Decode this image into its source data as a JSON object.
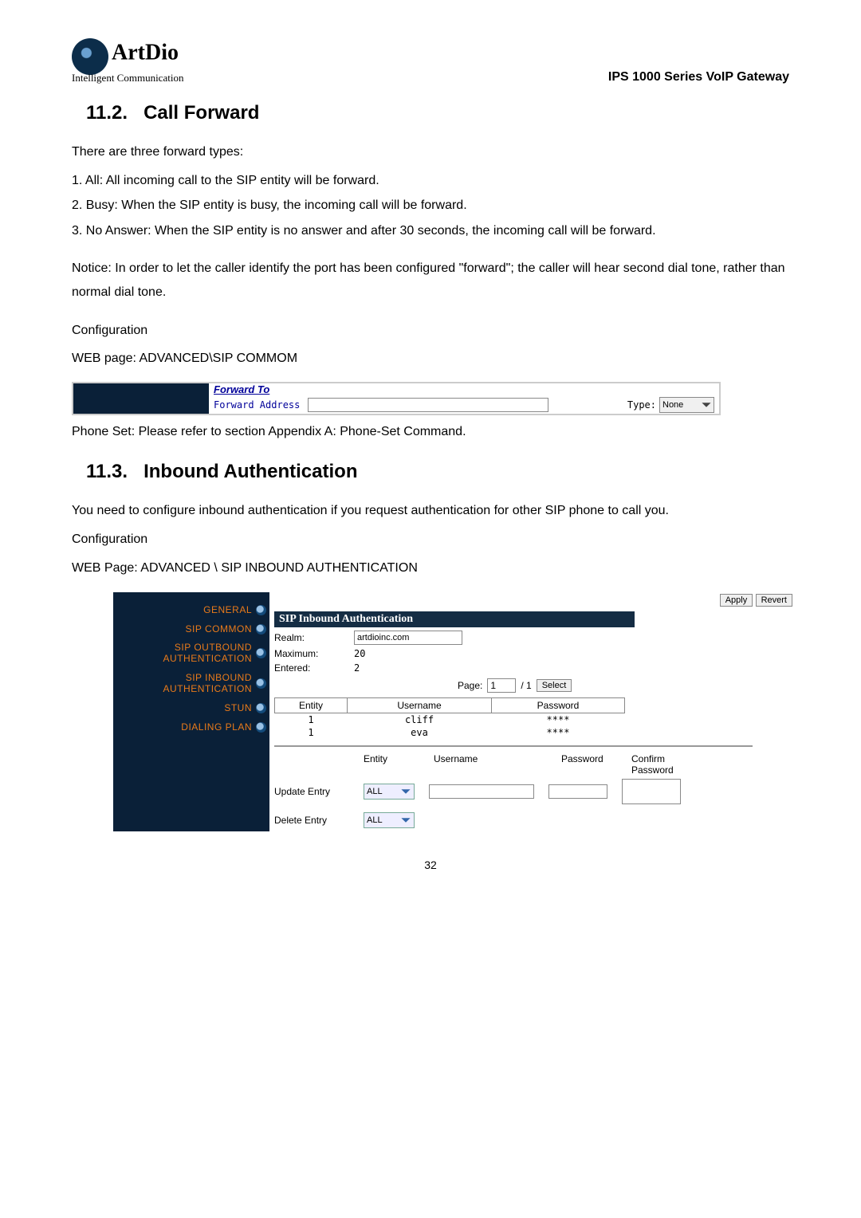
{
  "header": {
    "logo_main": "ArtDio",
    "logo_sub": "Intelligent Communication",
    "right": "IPS 1000 Series VoIP Gateway"
  },
  "sec1": {
    "num": "11.2.",
    "title": "Call Forward",
    "lead": "There are three forward types:",
    "items": [
      "1.  All: All incoming call to the SIP entity will be forward.",
      "2.  Busy: When the SIP entity is busy, the incoming call will be forward.",
      "3.  No Answer: When the SIP entity is no answer and after 30 seconds, the incoming call will be forward."
    ],
    "notice": "Notice: In order to let the caller identify the port has been configured \"forward\"; the caller will hear second dial tone, rather than normal dial tone.",
    "config_lbl": "Configuration",
    "web_lbl": "WEB page: ADVANCED\\SIP COMMOM"
  },
  "fwd": {
    "title": "Forward To",
    "addr_lbl": "Forward Address",
    "type_lbl": "Type:",
    "type_val": "None"
  },
  "after_fwd": "Phone Set: Please refer to section Appendix A: Phone-Set Command.",
  "sec2": {
    "num": "11.3.",
    "title": "Inbound Authentication",
    "lead": "You need to configure inbound authentication if you request authentication for other SIP phone to call you.",
    "config_lbl": "Configuration",
    "web_lbl": "WEB Page: ADVANCED \\ SIP INBOUND AUTHENTICATION"
  },
  "sidebar": {
    "items": [
      "GENERAL",
      "SIP COMMON",
      "SIP OUTBOUND\nAUTHENTICATION",
      "SIP INBOUND\nAUTHENTICATION",
      "STUN",
      "DIALING PLAN"
    ]
  },
  "auth": {
    "apply": "Apply",
    "revert": "Revert",
    "banner": "SIP Inbound Authentication",
    "realm_lbl": "Realm:",
    "realm_val": "artdioinc.com",
    "max_lbl": "Maximum:",
    "max_val": "20",
    "ent_lbl": "Entered:",
    "ent_val": "2",
    "page_lbl": "Page:",
    "page_val": "1",
    "page_tot": "/ 1",
    "select": "Select",
    "cols": {
      "entity": "Entity",
      "user": "Username",
      "pass": "Password"
    },
    "rows": [
      {
        "entity": "1",
        "user": "cliff",
        "pass": "****"
      },
      {
        "entity": "1",
        "user": "eva",
        "pass": "****"
      }
    ],
    "lower": {
      "entity_col": "Entity",
      "user_col": "Username",
      "pass_col": "Password",
      "confirm_col": "Confirm\nPassword",
      "update_lbl": "Update Entry",
      "delete_lbl": "Delete Entry",
      "all": "ALL"
    }
  },
  "page_num": "32"
}
